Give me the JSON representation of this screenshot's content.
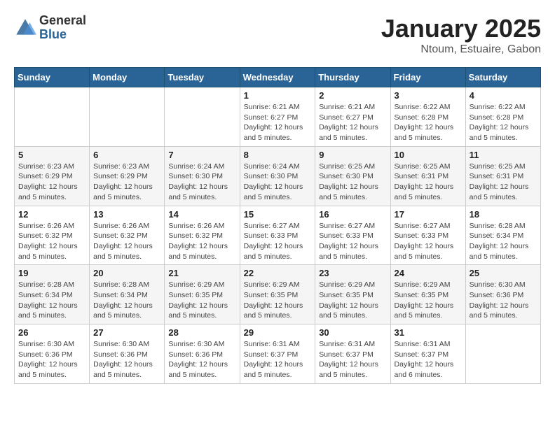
{
  "header": {
    "logo_general": "General",
    "logo_blue": "Blue",
    "title": "January 2025",
    "subtitle": "Ntoum, Estuaire, Gabon"
  },
  "days_of_week": [
    "Sunday",
    "Monday",
    "Tuesday",
    "Wednesday",
    "Thursday",
    "Friday",
    "Saturday"
  ],
  "weeks": [
    [
      {
        "day": "",
        "info": ""
      },
      {
        "day": "",
        "info": ""
      },
      {
        "day": "",
        "info": ""
      },
      {
        "day": "1",
        "info": "Sunrise: 6:21 AM\nSunset: 6:27 PM\nDaylight: 12 hours\nand 5 minutes."
      },
      {
        "day": "2",
        "info": "Sunrise: 6:21 AM\nSunset: 6:27 PM\nDaylight: 12 hours\nand 5 minutes."
      },
      {
        "day": "3",
        "info": "Sunrise: 6:22 AM\nSunset: 6:28 PM\nDaylight: 12 hours\nand 5 minutes."
      },
      {
        "day": "4",
        "info": "Sunrise: 6:22 AM\nSunset: 6:28 PM\nDaylight: 12 hours\nand 5 minutes."
      }
    ],
    [
      {
        "day": "5",
        "info": "Sunrise: 6:23 AM\nSunset: 6:29 PM\nDaylight: 12 hours\nand 5 minutes."
      },
      {
        "day": "6",
        "info": "Sunrise: 6:23 AM\nSunset: 6:29 PM\nDaylight: 12 hours\nand 5 minutes."
      },
      {
        "day": "7",
        "info": "Sunrise: 6:24 AM\nSunset: 6:30 PM\nDaylight: 12 hours\nand 5 minutes."
      },
      {
        "day": "8",
        "info": "Sunrise: 6:24 AM\nSunset: 6:30 PM\nDaylight: 12 hours\nand 5 minutes."
      },
      {
        "day": "9",
        "info": "Sunrise: 6:25 AM\nSunset: 6:30 PM\nDaylight: 12 hours\nand 5 minutes."
      },
      {
        "day": "10",
        "info": "Sunrise: 6:25 AM\nSunset: 6:31 PM\nDaylight: 12 hours\nand 5 minutes."
      },
      {
        "day": "11",
        "info": "Sunrise: 6:25 AM\nSunset: 6:31 PM\nDaylight: 12 hours\nand 5 minutes."
      }
    ],
    [
      {
        "day": "12",
        "info": "Sunrise: 6:26 AM\nSunset: 6:32 PM\nDaylight: 12 hours\nand 5 minutes."
      },
      {
        "day": "13",
        "info": "Sunrise: 6:26 AM\nSunset: 6:32 PM\nDaylight: 12 hours\nand 5 minutes."
      },
      {
        "day": "14",
        "info": "Sunrise: 6:26 AM\nSunset: 6:32 PM\nDaylight: 12 hours\nand 5 minutes."
      },
      {
        "day": "15",
        "info": "Sunrise: 6:27 AM\nSunset: 6:33 PM\nDaylight: 12 hours\nand 5 minutes."
      },
      {
        "day": "16",
        "info": "Sunrise: 6:27 AM\nSunset: 6:33 PM\nDaylight: 12 hours\nand 5 minutes."
      },
      {
        "day": "17",
        "info": "Sunrise: 6:27 AM\nSunset: 6:33 PM\nDaylight: 12 hours\nand 5 minutes."
      },
      {
        "day": "18",
        "info": "Sunrise: 6:28 AM\nSunset: 6:34 PM\nDaylight: 12 hours\nand 5 minutes."
      }
    ],
    [
      {
        "day": "19",
        "info": "Sunrise: 6:28 AM\nSunset: 6:34 PM\nDaylight: 12 hours\nand 5 minutes."
      },
      {
        "day": "20",
        "info": "Sunrise: 6:28 AM\nSunset: 6:34 PM\nDaylight: 12 hours\nand 5 minutes."
      },
      {
        "day": "21",
        "info": "Sunrise: 6:29 AM\nSunset: 6:35 PM\nDaylight: 12 hours\nand 5 minutes."
      },
      {
        "day": "22",
        "info": "Sunrise: 6:29 AM\nSunset: 6:35 PM\nDaylight: 12 hours\nand 5 minutes."
      },
      {
        "day": "23",
        "info": "Sunrise: 6:29 AM\nSunset: 6:35 PM\nDaylight: 12 hours\nand 5 minutes."
      },
      {
        "day": "24",
        "info": "Sunrise: 6:29 AM\nSunset: 6:35 PM\nDaylight: 12 hours\nand 5 minutes."
      },
      {
        "day": "25",
        "info": "Sunrise: 6:30 AM\nSunset: 6:36 PM\nDaylight: 12 hours\nand 5 minutes."
      }
    ],
    [
      {
        "day": "26",
        "info": "Sunrise: 6:30 AM\nSunset: 6:36 PM\nDaylight: 12 hours\nand 5 minutes."
      },
      {
        "day": "27",
        "info": "Sunrise: 6:30 AM\nSunset: 6:36 PM\nDaylight: 12 hours\nand 5 minutes."
      },
      {
        "day": "28",
        "info": "Sunrise: 6:30 AM\nSunset: 6:36 PM\nDaylight: 12 hours\nand 5 minutes."
      },
      {
        "day": "29",
        "info": "Sunrise: 6:31 AM\nSunset: 6:37 PM\nDaylight: 12 hours\nand 5 minutes."
      },
      {
        "day": "30",
        "info": "Sunrise: 6:31 AM\nSunset: 6:37 PM\nDaylight: 12 hours\nand 5 minutes."
      },
      {
        "day": "31",
        "info": "Sunrise: 6:31 AM\nSunset: 6:37 PM\nDaylight: 12 hours\nand 6 minutes."
      },
      {
        "day": "",
        "info": ""
      }
    ]
  ]
}
